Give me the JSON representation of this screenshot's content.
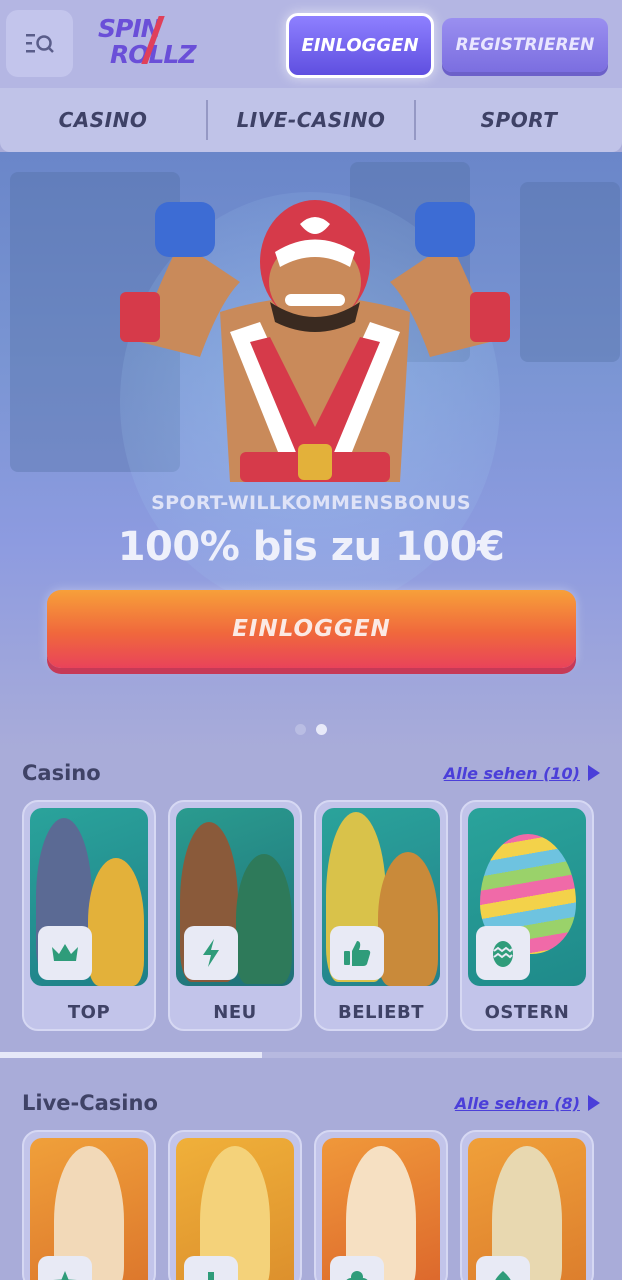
{
  "header": {
    "menu_icon": "search-list-icon",
    "logo_line1": "SPIN",
    "logo_line2": "ROLLZ",
    "login_label": "EINLOGGEN",
    "register_label": "REGISTRIEREN"
  },
  "nav": {
    "tabs": [
      {
        "label": "CASINO"
      },
      {
        "label": "LIVE-CASINO"
      },
      {
        "label": "SPORT"
      }
    ]
  },
  "hero": {
    "subtitle": "SPORT-WILLKOMMENSBONUS",
    "title": "100% bis zu 100€",
    "cta_label": "EINLOGGEN",
    "slide_count": 2,
    "active_slide": 2
  },
  "casino": {
    "title": "Casino",
    "see_all": "Alle sehen (10)",
    "categories": [
      {
        "label": "TOP",
        "icon": "crown-icon"
      },
      {
        "label": "NEU",
        "icon": "lightning-icon"
      },
      {
        "label": "BELIEBT",
        "icon": "thumbs-up-icon"
      },
      {
        "label": "OSTERN",
        "icon": "easter-egg-icon"
      }
    ]
  },
  "live_casino": {
    "title": "Live-Casino",
    "see_all": "Alle sehen (8)",
    "categories": [
      {
        "icon": "star-icon"
      },
      {
        "icon": "plus-icon"
      },
      {
        "icon": "clover-icon"
      },
      {
        "icon": "spade-icon"
      }
    ]
  },
  "colors": {
    "accent": "#5f4fe0",
    "cta_orange": "#f0683c",
    "badge_green": "#2f9c7a"
  }
}
